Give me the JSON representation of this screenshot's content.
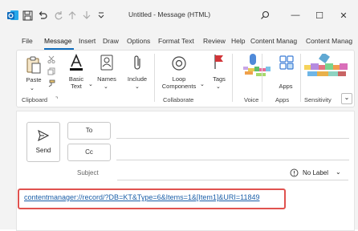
{
  "window": {
    "title": "Untitled  -  Message (HTML)",
    "controls": {
      "minimize": "—",
      "maximize": "☐",
      "close": "✕"
    }
  },
  "tabs": [
    "File",
    "Message",
    "Insert",
    "Draw",
    "Options",
    "Format Text",
    "Review",
    "Help",
    "Content Manag",
    "Content Manag"
  ],
  "ribbon": {
    "paste": "Paste",
    "basic_text": "Basic",
    "basic_text2": "Text",
    "names": "Names",
    "include": "Include",
    "loop": "Loop",
    "loop2": "Components",
    "tags": "Tags",
    "apps": "Apps",
    "groups": {
      "clipboard": "Clipboard",
      "collaborate": "Collaborate",
      "voice": "Voice",
      "apps": "Apps",
      "sensitivity": "Sensitivity"
    }
  },
  "compose": {
    "send": "Send",
    "to": "To",
    "cc": "Cc",
    "subject": "Subject",
    "no_label": "No Label",
    "body_url": "contentmanager://record/?DB=KT&Type=6&Items=1&[Item1]&URI=11849"
  },
  "colors": {
    "accent": "#0f6cbd",
    "highlight_box": "#e0524f",
    "link": "#1a5ea8",
    "outlook_blue": "#0f6cbd"
  }
}
